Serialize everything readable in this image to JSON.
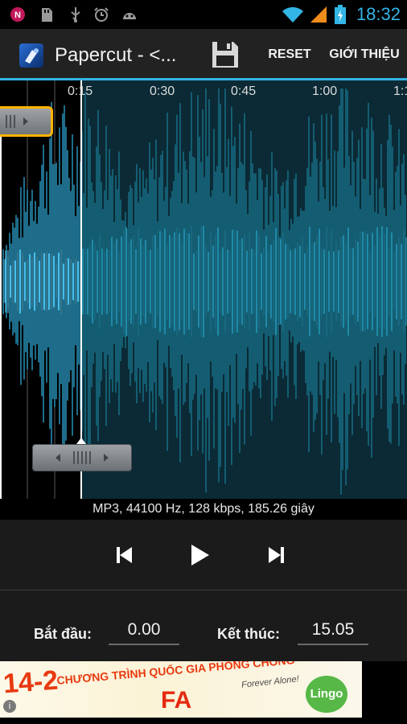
{
  "status_bar": {
    "time": "18:32",
    "icons": [
      "app-notification-icon",
      "sd-card-icon",
      "usb-icon",
      "alarm-icon",
      "android-debug-icon",
      "wifi-icon",
      "signal-icon",
      "battery-charging-icon"
    ]
  },
  "action_bar": {
    "title": "Papercut - <...",
    "save_icon": "floppy-disk-icon",
    "reset_label": "RESET",
    "about_label": "GIỚI THIỆU",
    "accent_color": "#33b5e5"
  },
  "waveform": {
    "time_labels": [
      "0:15",
      "0:30",
      "0:45",
      "1:00",
      "1:1"
    ],
    "selected_color": "#33b5e5",
    "unselected_color": "#1a7f99",
    "background_selected": "#000000",
    "background_unselected": "#0b2a35"
  },
  "file_info": "MP3, 44100 Hz, 128 kbps, 185.26 giây",
  "controls": {
    "previous_icon": "skip-previous-icon",
    "play_icon": "play-icon",
    "next_icon": "skip-next-icon"
  },
  "selection": {
    "start_label": "Bắt đầu:",
    "start_value": "0.00",
    "end_label": "Kết thúc:",
    "end_value": "15.05"
  },
  "ad": {
    "date": "14-2",
    "headline": "CHƯƠNG TRÌNH QUỐC GIA PHÒNG CHỐNG",
    "highlight": "FA",
    "tagline": "Forever Alone!",
    "brand": "Lingo"
  }
}
